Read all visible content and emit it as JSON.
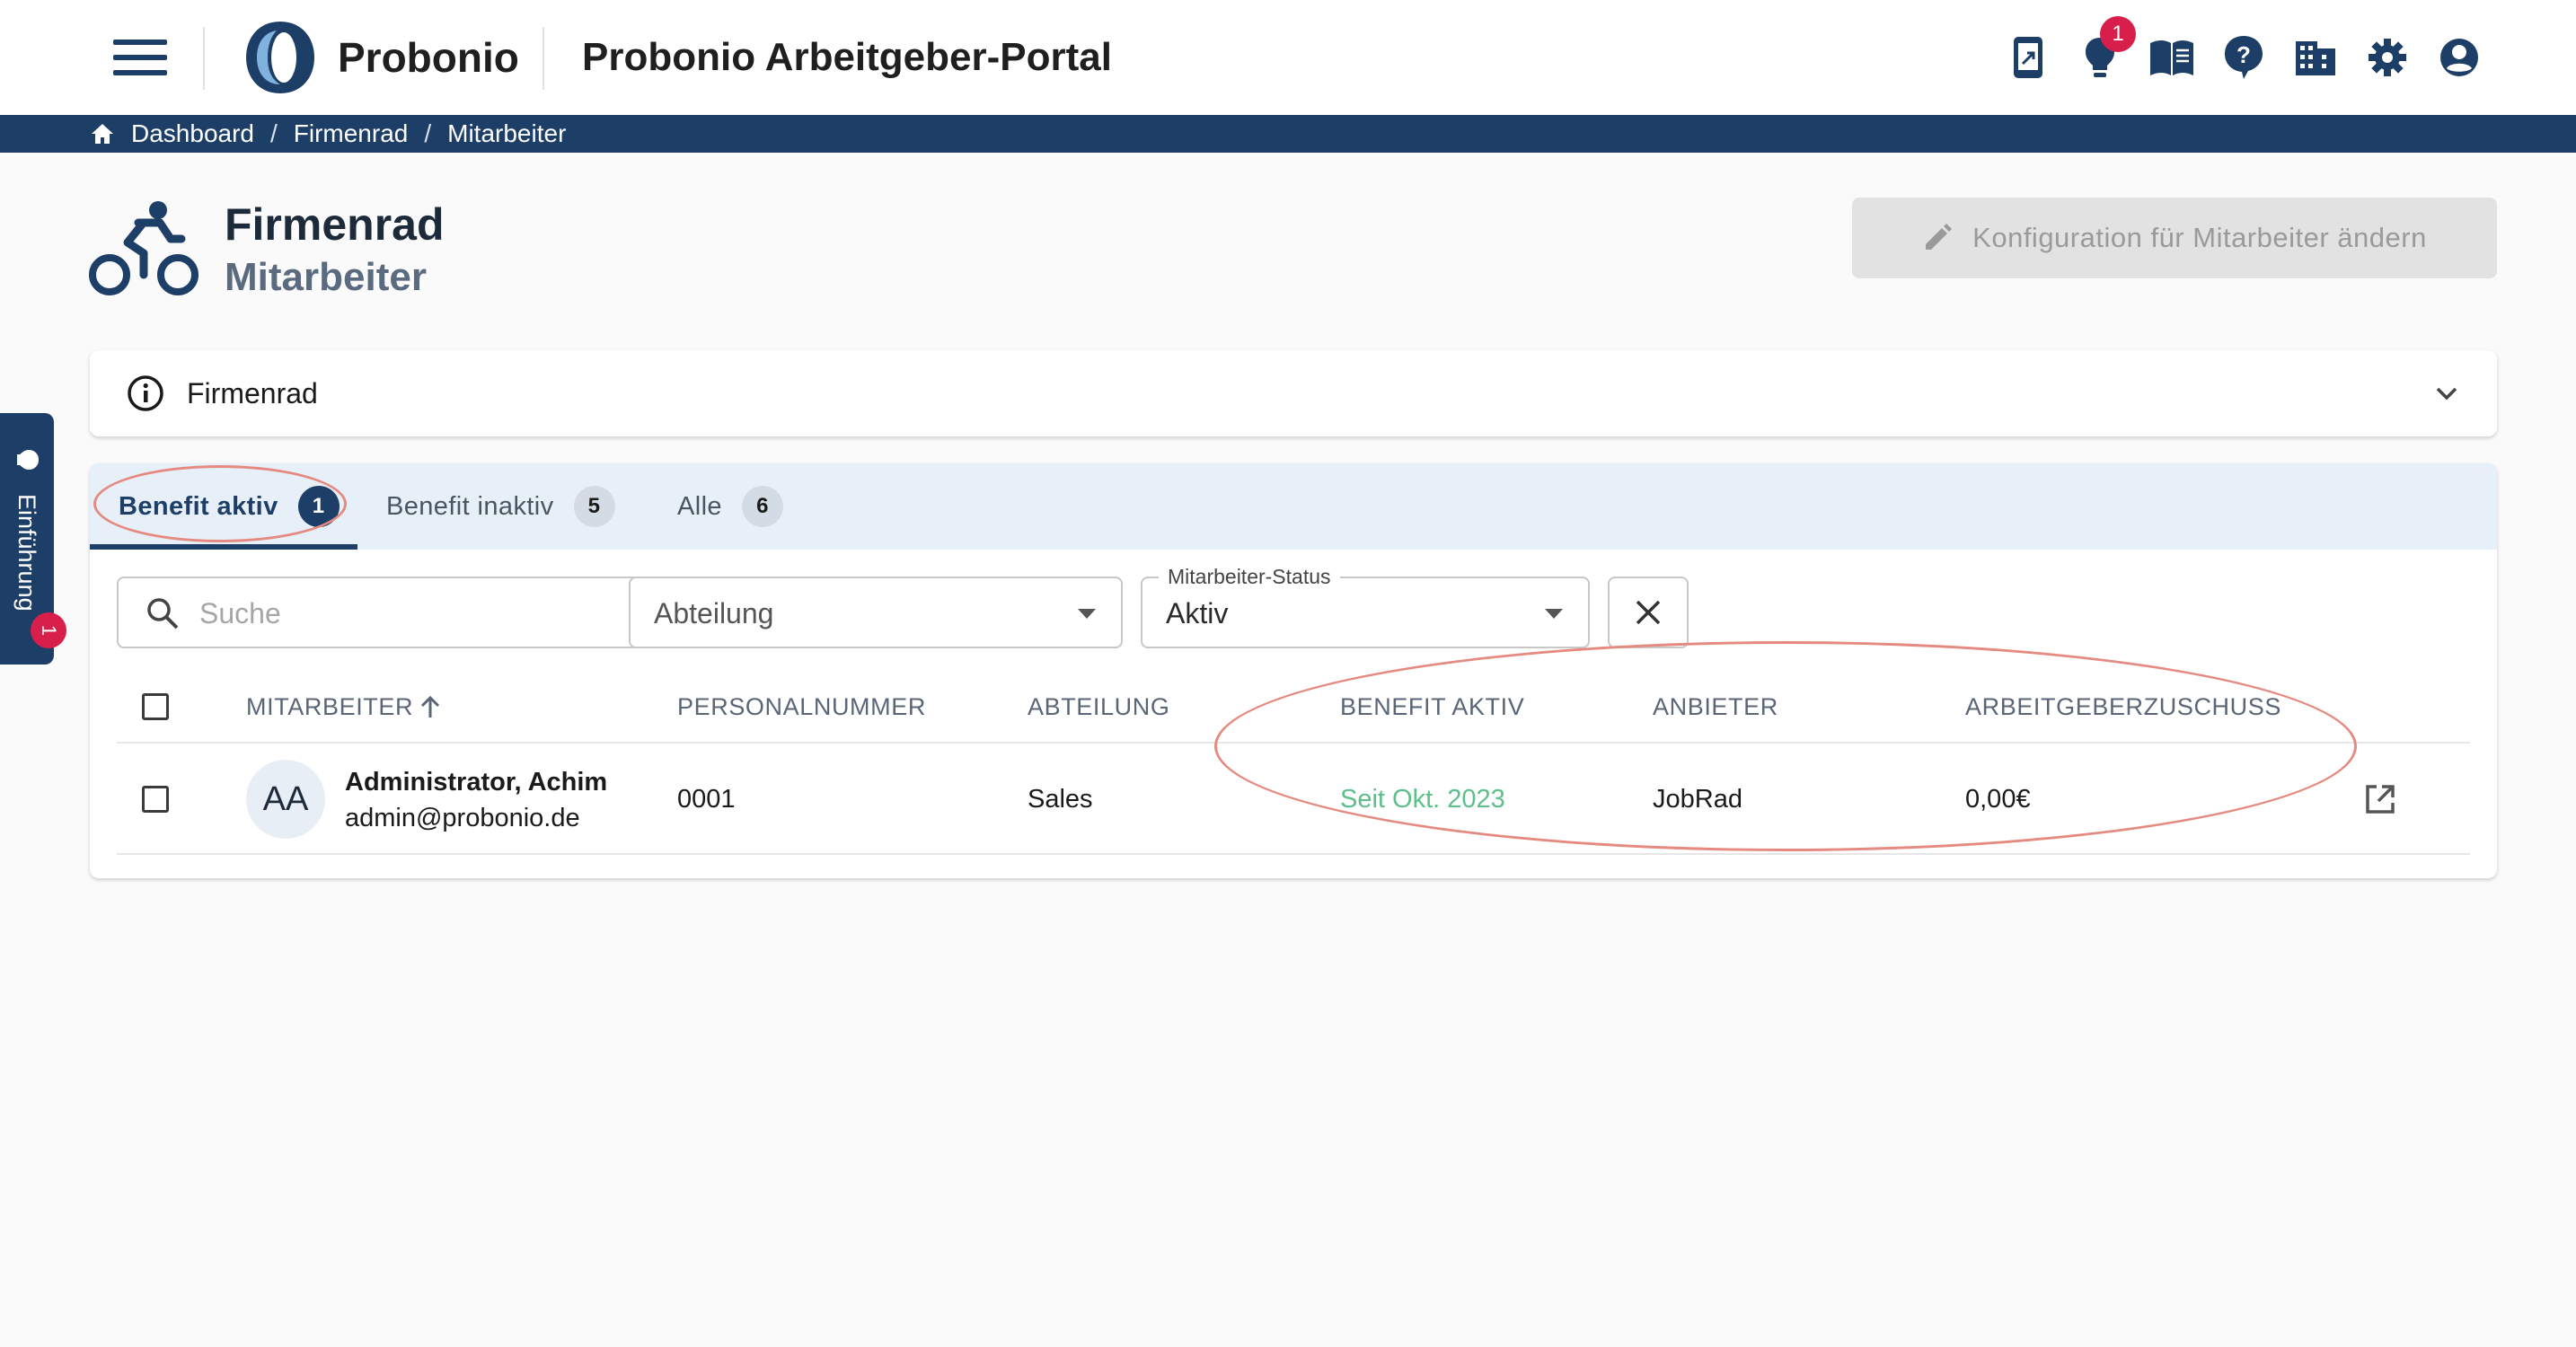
{
  "header": {
    "brand": "Probonio",
    "portal_title": "Probonio Arbeitgeber-Portal",
    "notification_count": "1",
    "icons": [
      "menu-icon",
      "mobile-share-icon",
      "lightbulb-icon",
      "book-icon",
      "help-icon",
      "building-icon",
      "gear-icon",
      "account-icon"
    ]
  },
  "breadcrumb": {
    "items": [
      "Dashboard",
      "Firmenrad",
      "Mitarbeiter"
    ],
    "separator": "/"
  },
  "page": {
    "title": "Firmenrad",
    "subtitle": "Mitarbeiter",
    "config_button": "Konfiguration für Mitarbeiter ändern"
  },
  "info_panel": {
    "label": "Firmenrad"
  },
  "tabs": [
    {
      "label": "Benefit aktiv",
      "count": "1",
      "active": true
    },
    {
      "label": "Benefit inaktiv",
      "count": "5",
      "active": false
    },
    {
      "label": "Alle",
      "count": "6",
      "active": false
    }
  ],
  "filters": {
    "search_placeholder": "Suche",
    "department_placeholder": "Abteilung",
    "status_label": "Mitarbeiter-Status",
    "status_value": "Aktiv"
  },
  "table": {
    "columns": [
      "MITARBEITER",
      "PERSONALNUMMER",
      "ABTEILUNG",
      "BENEFIT AKTIV",
      "ANBIETER",
      "ARBEITGEBERZUSCHUSS"
    ],
    "rows": [
      {
        "initials": "AA",
        "name": "Administrator, Achim",
        "email": "admin@probonio.de",
        "personnel_number": "0001",
        "department": "Sales",
        "benefit_active": "Seit Okt. 2023",
        "provider": "JobRad",
        "employer_subsidy": "0,00€"
      }
    ]
  },
  "side_tab": {
    "label": "Einführung",
    "badge": "1"
  },
  "colors": {
    "primary": "#1d3e66",
    "badge": "#d81e4a",
    "active_green": "#5cc08a",
    "annotation": "#e58a80"
  }
}
